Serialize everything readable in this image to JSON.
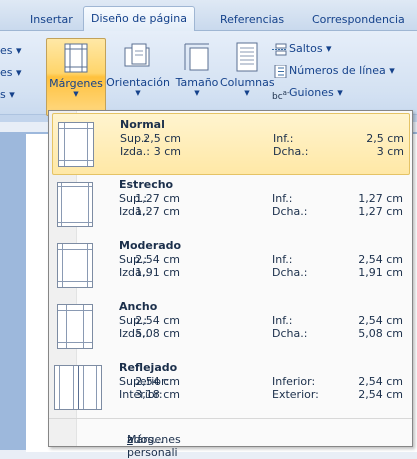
{
  "tabs": [
    {
      "label": "Insertar"
    },
    {
      "label": "Diseño de página"
    },
    {
      "label": "Referencias"
    },
    {
      "label": "Correspondencia"
    }
  ],
  "ribbon": {
    "left_stubs": [
      "es ▾",
      "es ▾",
      "s ▾"
    ],
    "buttons": [
      {
        "label": "Márgenes",
        "icon": "margins-icon"
      },
      {
        "label": "Orientación",
        "icon": "orientation-icon"
      },
      {
        "label": "Tamaño",
        "icon": "size-icon"
      },
      {
        "label": "Columnas",
        "icon": "columns-icon"
      }
    ],
    "side_items": [
      {
        "label": "Saltos ▾",
        "icon": "breaks-icon"
      },
      {
        "label": "Números de línea ▾",
        "icon": "line-numbers-icon"
      },
      {
        "label": "Guiones ▾",
        "icon": "hyphenation-icon"
      }
    ]
  },
  "menu": {
    "items": [
      {
        "name": "Normal",
        "l1": "Sup.:",
        "v1": "2,5 cm",
        "r1": "Inf.:",
        "w1": "2,5 cm",
        "l2": "Izda.:",
        "v2": "3 cm",
        "r2": "Dcha.:",
        "w2": "3 cm"
      },
      {
        "name": "Estrecho",
        "l1": "Sup.:",
        "v1": "1,27 cm",
        "r1": "Inf.:",
        "w1": "1,27 cm",
        "l2": "Izda.:",
        "v2": "1,27 cm",
        "r2": "Dcha.:",
        "w2": "1,27 cm"
      },
      {
        "name": "Moderado",
        "l1": "Sup.:",
        "v1": "2,54 cm",
        "r1": "Inf.:",
        "w1": "2,54 cm",
        "l2": "Izda.:",
        "v2": "1,91 cm",
        "r2": "Dcha.:",
        "w2": "1,91 cm"
      },
      {
        "name": "Ancho",
        "l1": "Sup.:",
        "v1": "2,54 cm",
        "r1": "Inf.:",
        "w1": "2,54 cm",
        "l2": "Izda.:",
        "v2": "5,08 cm",
        "r2": "Dcha.:",
        "w2": "5,08 cm"
      },
      {
        "name": "Reflejado",
        "l1": "Superior:",
        "v1": "2,54 cm",
        "r1": "Inferior:",
        "w1": "2,54 cm",
        "l2": "Interior:",
        "v2": "3,18 cm",
        "r2": "Exterior:",
        "w2": "2,54 cm"
      }
    ],
    "custom": {
      "before": "Márgenes personali",
      "underline": "z",
      "after": "ados..."
    }
  },
  "colors": {
    "accent": "#ffd56b",
    "tab_text": "#15428b"
  }
}
